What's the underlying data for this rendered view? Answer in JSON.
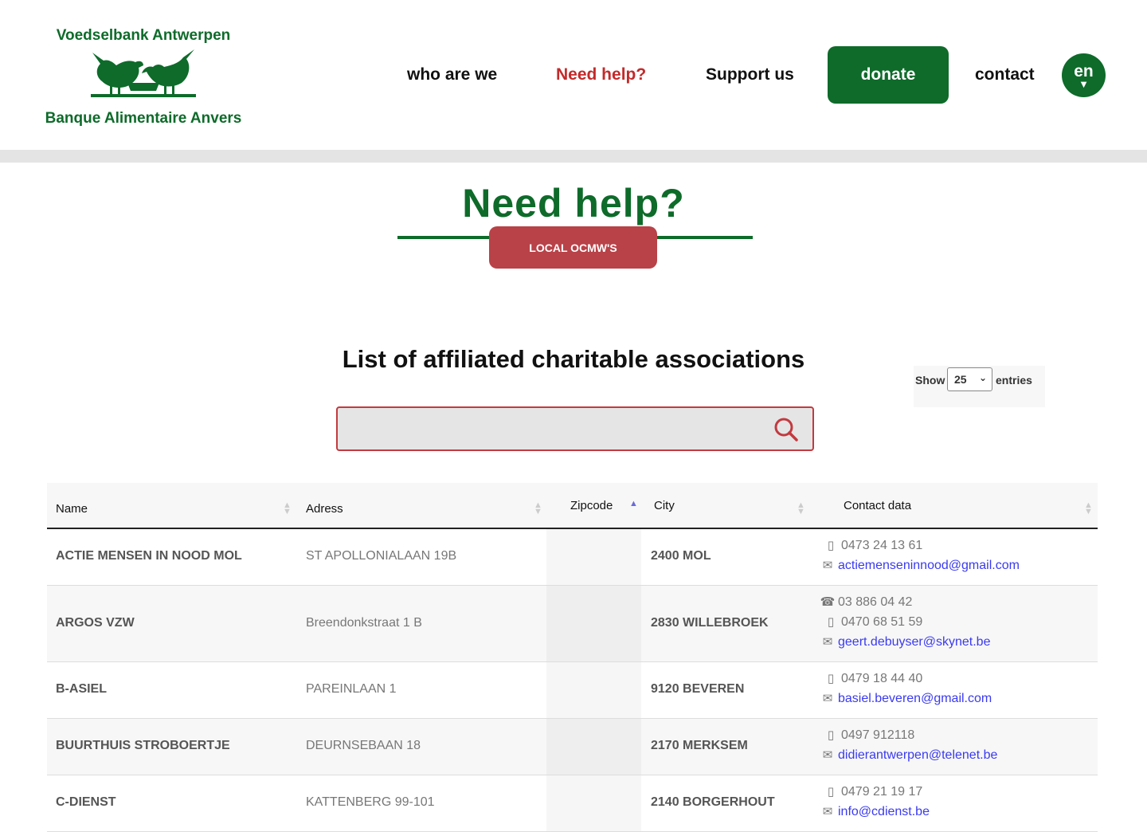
{
  "logo": {
    "top": "Voedselbank Antwerpen",
    "bottom": "Banque Alimentaire Anvers"
  },
  "nav": {
    "who": "who are we",
    "need": "Need help?",
    "support": "Support us",
    "donate": "donate",
    "contact": "contact",
    "lang": "en"
  },
  "colors": {
    "brand_green": "#0e6b2a",
    "accent_red": "#c42a2a",
    "badge_red": "#b84248",
    "email_link": "#3a3af0"
  },
  "hero": {
    "title": "Need help?",
    "badge": "LOCAL OCMW'S"
  },
  "list": {
    "title": "List of affiliated charitable associations"
  },
  "show": {
    "label": "Show",
    "value": "25",
    "entries": "entries"
  },
  "search": {
    "placeholder": "",
    "icon": "search-icon"
  },
  "table": {
    "headers": {
      "name": "Name",
      "address": "Adress",
      "zip": "Zipcode",
      "city": "City",
      "contact": "Contact data"
    },
    "rows": [
      {
        "name": "ACTIE MENSEN IN NOOD MOL",
        "address": "ST APOLLONIALAAN 19B",
        "city": "2400 MOL",
        "phone": "",
        "mobile": "0473 24 13 61",
        "email": "actiemenseninnood@gmail.com"
      },
      {
        "name": "ARGOS VZW",
        "address": "Breendonkstraat 1 B",
        "city": "2830 WILLEBROEK",
        "phone": "03 886 04 42",
        "mobile": "0470 68 51 59",
        "email": "geert.debuyser@skynet.be"
      },
      {
        "name": "B-ASIEL",
        "address": "PAREINLAAN 1",
        "city": "9120 BEVEREN",
        "phone": "",
        "mobile": "0479 18 44 40",
        "email": "basiel.beveren@gmail.com"
      },
      {
        "name": "BUURTHUIS STROBOERTJE",
        "address": "DEURNSEBAAN 18",
        "city": "2170 MERKSEM",
        "phone": "",
        "mobile": "0497 912118",
        "email": "didierantwerpen@telenet.be"
      },
      {
        "name": "C-DIENST",
        "address": "KATTENBERG 99-101",
        "city": "2140 BORGERHOUT",
        "phone": "",
        "mobile": "0479 21 19 17",
        "email": "info@cdienst.be"
      }
    ]
  }
}
